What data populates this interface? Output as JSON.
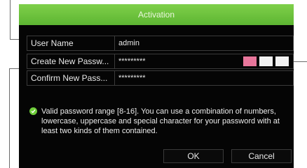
{
  "dialog": {
    "title": "Activation",
    "fields": [
      {
        "label": "User Name",
        "value": "admin"
      },
      {
        "label": "Create New Passw...",
        "value": "*********"
      },
      {
        "label": "Confirm New Pass...",
        "value": "*********"
      }
    ],
    "password_strength": {
      "segments": [
        "active",
        "inactive",
        "inactive"
      ],
      "colors": {
        "active": "#e8769b",
        "inactive": "#f2f2f2"
      }
    },
    "note": "Valid password range [8-16]. You can use a combination of numbers, lowercase, uppercase and special character for your password with at least two kinds of them contained.",
    "buttons": {
      "ok": "OK",
      "cancel": "Cancel"
    }
  },
  "colors": {
    "titlebar": "#5db532",
    "dialog_bg": "#050505",
    "check": "#6fcd3a"
  }
}
